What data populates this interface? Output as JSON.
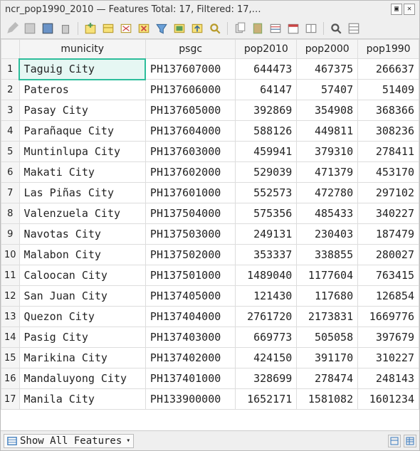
{
  "window": {
    "title": "ncr_pop1990_2010 — Features Total: 17, Filtered: 17,…"
  },
  "toolbar": {
    "icons": [
      "pencil-icon",
      "edit-icon",
      "save-icon",
      "trash-icon",
      "add-feature-icon",
      "table-select-icon",
      "deselect-icon",
      "delete-selected-icon",
      "filter-icon",
      "select-all-icon",
      "move-top-icon",
      "zoom-icon",
      "copy-icon",
      "paste-icon",
      "column-calc-icon",
      "calendar-icon",
      "conditional-icon",
      "search-icon",
      "form-view-icon"
    ]
  },
  "columns": [
    "municity",
    "psgc",
    "pop2010",
    "pop2000",
    "pop1990"
  ],
  "rows": [
    {
      "n": 1,
      "municity": "Taguig City",
      "psgc": "PH137607000",
      "pop2010": 644473,
      "pop2000": 467375,
      "pop1990": 266637
    },
    {
      "n": 2,
      "municity": "Pateros",
      "psgc": "PH137606000",
      "pop2010": 64147,
      "pop2000": 57407,
      "pop1990": 51409
    },
    {
      "n": 3,
      "municity": "Pasay City",
      "psgc": "PH137605000",
      "pop2010": 392869,
      "pop2000": 354908,
      "pop1990": 368366
    },
    {
      "n": 4,
      "municity": "Parañaque City",
      "psgc": "PH137604000",
      "pop2010": 588126,
      "pop2000": 449811,
      "pop1990": 308236
    },
    {
      "n": 5,
      "municity": "Muntinlupa City",
      "psgc": "PH137603000",
      "pop2010": 459941,
      "pop2000": 379310,
      "pop1990": 278411
    },
    {
      "n": 6,
      "municity": "Makati City",
      "psgc": "PH137602000",
      "pop2010": 529039,
      "pop2000": 471379,
      "pop1990": 453170
    },
    {
      "n": 7,
      "municity": "Las Piñas City",
      "psgc": "PH137601000",
      "pop2010": 552573,
      "pop2000": 472780,
      "pop1990": 297102
    },
    {
      "n": 8,
      "municity": "Valenzuela City",
      "psgc": "PH137504000",
      "pop2010": 575356,
      "pop2000": 485433,
      "pop1990": 340227
    },
    {
      "n": 9,
      "municity": "Navotas City",
      "psgc": "PH137503000",
      "pop2010": 249131,
      "pop2000": 230403,
      "pop1990": 187479
    },
    {
      "n": 10,
      "municity": "Malabon City",
      "psgc": "PH137502000",
      "pop2010": 353337,
      "pop2000": 338855,
      "pop1990": 280027
    },
    {
      "n": 11,
      "municity": "Caloocan City",
      "psgc": "PH137501000",
      "pop2010": 1489040,
      "pop2000": 1177604,
      "pop1990": 763415
    },
    {
      "n": 12,
      "municity": "San Juan City",
      "psgc": "PH137405000",
      "pop2010": 121430,
      "pop2000": 117680,
      "pop1990": 126854
    },
    {
      "n": 13,
      "municity": "Quezon City",
      "psgc": "PH137404000",
      "pop2010": 2761720,
      "pop2000": 2173831,
      "pop1990": 1669776
    },
    {
      "n": 14,
      "municity": "Pasig City",
      "psgc": "PH137403000",
      "pop2010": 669773,
      "pop2000": 505058,
      "pop1990": 397679
    },
    {
      "n": 15,
      "municity": "Marikina City",
      "psgc": "PH137402000",
      "pop2010": 424150,
      "pop2000": 391170,
      "pop1990": 310227
    },
    {
      "n": 16,
      "municity": "Mandaluyong City",
      "psgc": "PH137401000",
      "pop2010": 328699,
      "pop2000": 278474,
      "pop1990": 248143
    },
    {
      "n": 17,
      "municity": "Manila City",
      "psgc": "PH133900000",
      "pop2010": 1652171,
      "pop2000": 1581082,
      "pop1990": 1601234
    }
  ],
  "selected_cell": {
    "row": 1,
    "col": "municity"
  },
  "status": {
    "filter_mode": "Show All Features"
  }
}
